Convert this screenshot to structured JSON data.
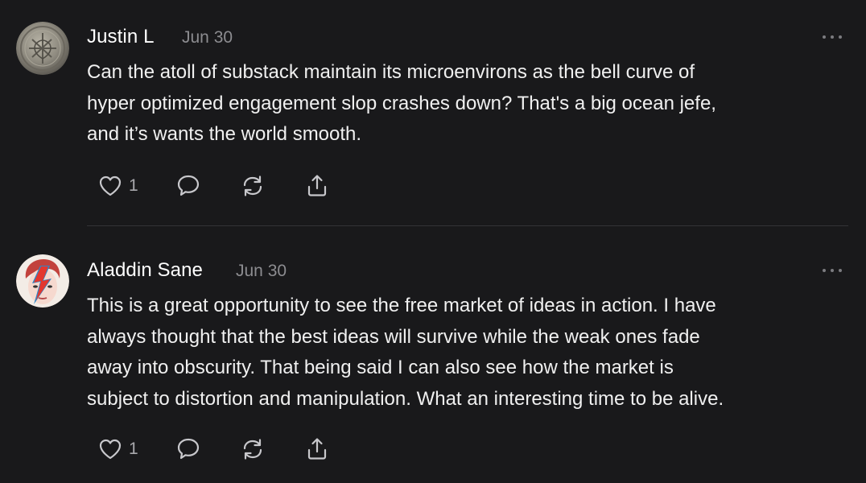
{
  "comments": [
    {
      "author": "Justin L",
      "date": "Jun 30",
      "avatar_icon": "coin-avatar-icon",
      "body_lines": [
        "Can the atoll of substack maintain its microenvirons as the bell curve of",
        "hyper optimized engagement slop crashes down? That's a big ocean jefe,",
        "and it’s wants the world smooth."
      ],
      "likes": "1"
    },
    {
      "author": "Aladdin Sane",
      "date": "Jun 30",
      "avatar_icon": "lightning-face-avatar-icon",
      "body_lines": [
        "This is a great opportunity to see the free market of ideas in action. I have",
        "always thought that the best ideas will survive while the weak ones fade",
        "away into obscurity. That being said I can also see how the market is",
        "subject to distortion and manipulation. What an interesting time to be alive."
      ],
      "likes": "1"
    }
  ],
  "colors": {
    "background": "#19191b",
    "text": "#f0f0f0",
    "muted": "#8c8c90",
    "divider": "#333336"
  }
}
